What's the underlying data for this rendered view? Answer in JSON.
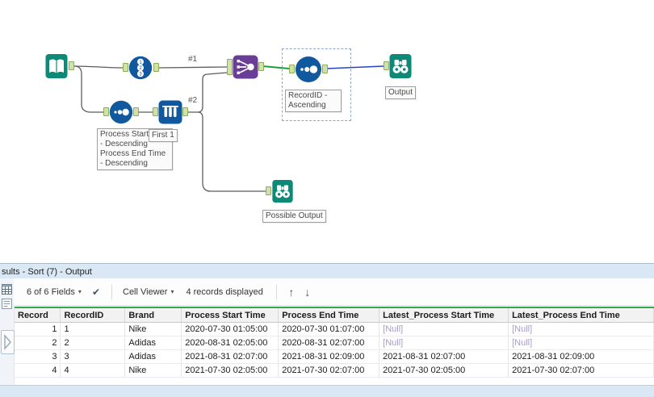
{
  "colors": {
    "tool_teal": "#0d8a77",
    "tool_blue": "#11599e",
    "tool_purple": "#6a3d96",
    "anchor_green": "#cfe3a9",
    "wire_default": "#5c5c5c",
    "wire_selected_green": "#1e9e40",
    "wire_selected_blue": "#2743c8",
    "grid_accent_green": "#2fa84f",
    "null_text": "#a89cc8",
    "panel_blue": "#d9e8f4"
  },
  "icons": {
    "caret_down": "▾",
    "check": "✔",
    "arrow_up": "↑",
    "arrow_down": "↓"
  },
  "canvas": {
    "connection_labels": {
      "first": "#1",
      "second": "#2"
    },
    "annotations": {
      "sort_descending": "Process Start Time - Descending Process End Time - Descending",
      "first_1": "First 1",
      "recordid_ascending": "RecordID - Ascending",
      "output": "Output",
      "possible_output": "Possible Output"
    }
  },
  "results": {
    "title": "sults - Sort (7) - Output",
    "toolbar": {
      "fields_dropdown": "6 of 6 Fields",
      "cell_viewer_dropdown": "Cell Viewer",
      "records_displayed": "4 records displayed"
    },
    "table": {
      "columns": [
        "Record",
        "RecordID",
        "Brand",
        "Process Start Time",
        "Process End Time",
        "Latest_Process Start Time",
        "Latest_Process End Time"
      ],
      "rows": [
        [
          "1",
          "1",
          "Nike",
          "2020-07-30 01:05:00",
          "2020-07-30 01:07:00",
          "[Null]",
          "[Null]"
        ],
        [
          "2",
          "2",
          "Adidas",
          "2020-08-31 02:05:00",
          "2020-08-31 02:07:00",
          "[Null]",
          "[Null]"
        ],
        [
          "3",
          "3",
          "Adidas",
          "2021-08-31 02:07:00",
          "2021-08-31 02:09:00",
          "2021-08-31 02:07:00",
          "2021-08-31 02:09:00"
        ],
        [
          "4",
          "4",
          "Nike",
          "2021-07-30 02:05:00",
          "2021-07-30 02:07:00",
          "2021-07-30 02:05:00",
          "2021-07-30 02:07:00"
        ]
      ]
    }
  }
}
